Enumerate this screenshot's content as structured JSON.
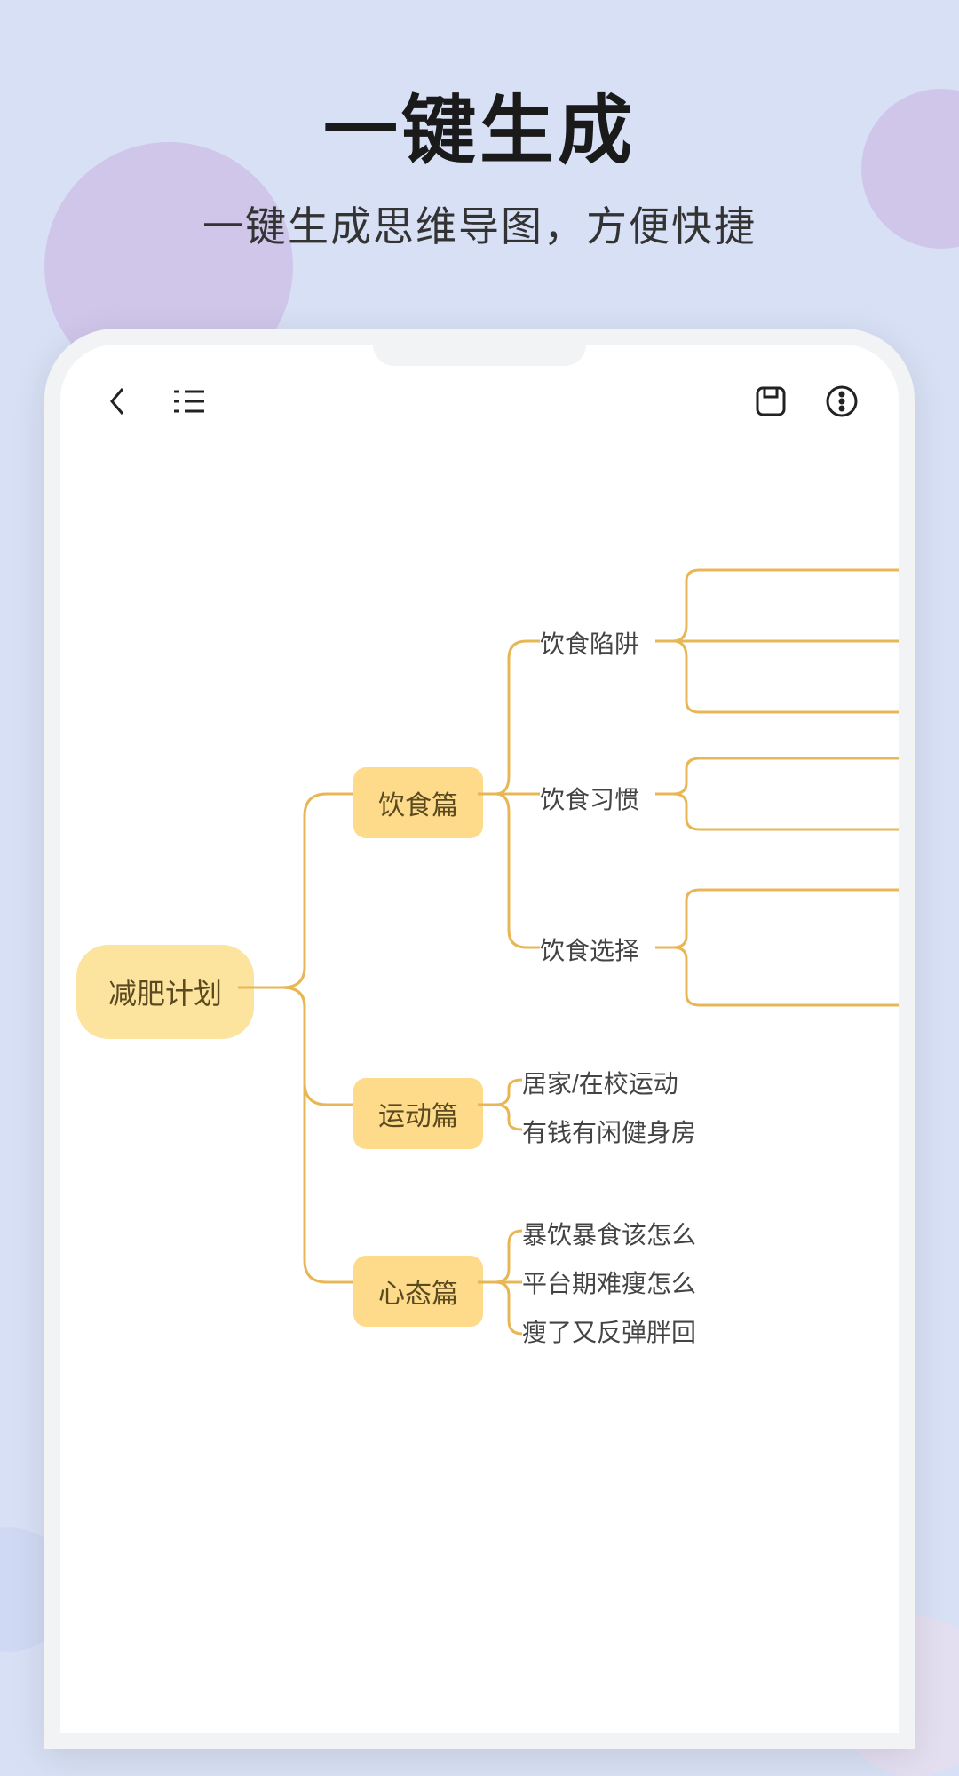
{
  "hero": {
    "title": "一键生成",
    "subtitle": "一键生成思维导图，方便快捷"
  },
  "colors": {
    "bgPage": "#D8E0F5",
    "nodeRoot": "#FCE49F",
    "nodeBranch": "#FDDB8B",
    "connector": "#E8B755"
  },
  "mindmap": {
    "root": "减肥计划",
    "branches": [
      {
        "label": "饮食篇",
        "children": [
          "饮食陷阱",
          "饮食习惯",
          "饮食选择"
        ]
      },
      {
        "label": "运动篇",
        "children": [
          "居家/在校运动",
          "有钱有闲健身房"
        ]
      },
      {
        "label": "心态篇",
        "children": [
          "暴饮暴食该怎么",
          "平台期难瘦怎么",
          "瘦了又反弹胖回"
        ]
      }
    ]
  }
}
